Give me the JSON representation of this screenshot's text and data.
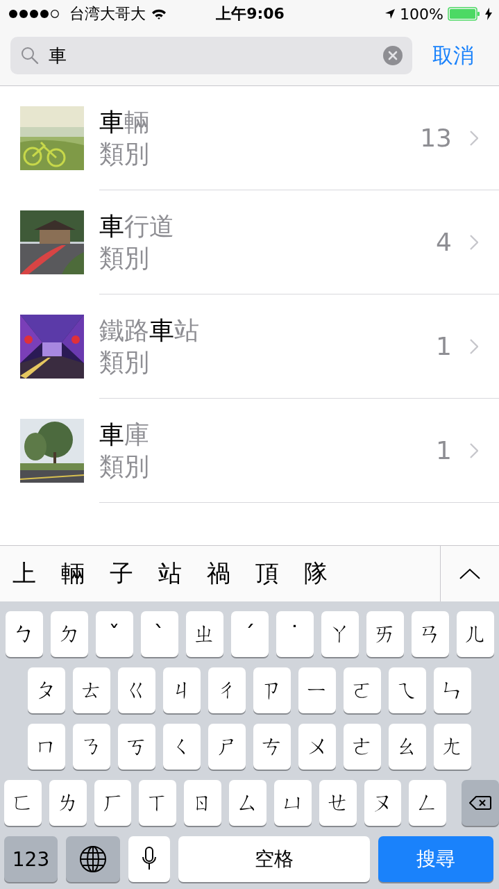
{
  "status_bar": {
    "carrier": "台湾大哥大",
    "time": "上午9:06",
    "battery": "100%"
  },
  "search": {
    "value": "車",
    "cancel": "取消"
  },
  "results": [
    {
      "title": "**車**輛",
      "subtitle": "類別",
      "count": "13"
    },
    {
      "title": "**車**行道",
      "subtitle": "類別",
      "count": "4"
    },
    {
      "title": "鐵路**車**站",
      "subtitle": "類別",
      "count": "1"
    },
    {
      "title": "**車**庫",
      "subtitle": "類別",
      "count": "1"
    }
  ],
  "keyboard": {
    "candidates": [
      "上",
      "輛",
      "子",
      "站",
      "禍",
      "頂",
      "隊"
    ],
    "rows": [
      [
        "ㄅ",
        "ㄉ",
        "ˇ",
        "ˋ",
        "ㄓ",
        "ˊ",
        "˙",
        "ㄚ",
        "ㄞ",
        "ㄢ",
        "ㄦ"
      ],
      [
        "ㄆ",
        "ㄊ",
        "ㄍ",
        "ㄐ",
        "ㄔ",
        "ㄗ",
        "ㄧ",
        "ㄛ",
        "ㄟ",
        "ㄣ"
      ],
      [
        "ㄇ",
        "ㄋ",
        "ㄎ",
        "ㄑ",
        "ㄕ",
        "ㄘ",
        "ㄨ",
        "ㄜ",
        "ㄠ",
        "ㄤ"
      ],
      [
        "ㄈ",
        "ㄌ",
        "ㄏ",
        "ㄒ",
        "ㄖ",
        "ㄙ",
        "ㄩ",
        "ㄝ",
        "ㄡ",
        "ㄥ"
      ]
    ],
    "numbers_key": "123",
    "space_key": "空格",
    "search_key": "搜尋"
  }
}
